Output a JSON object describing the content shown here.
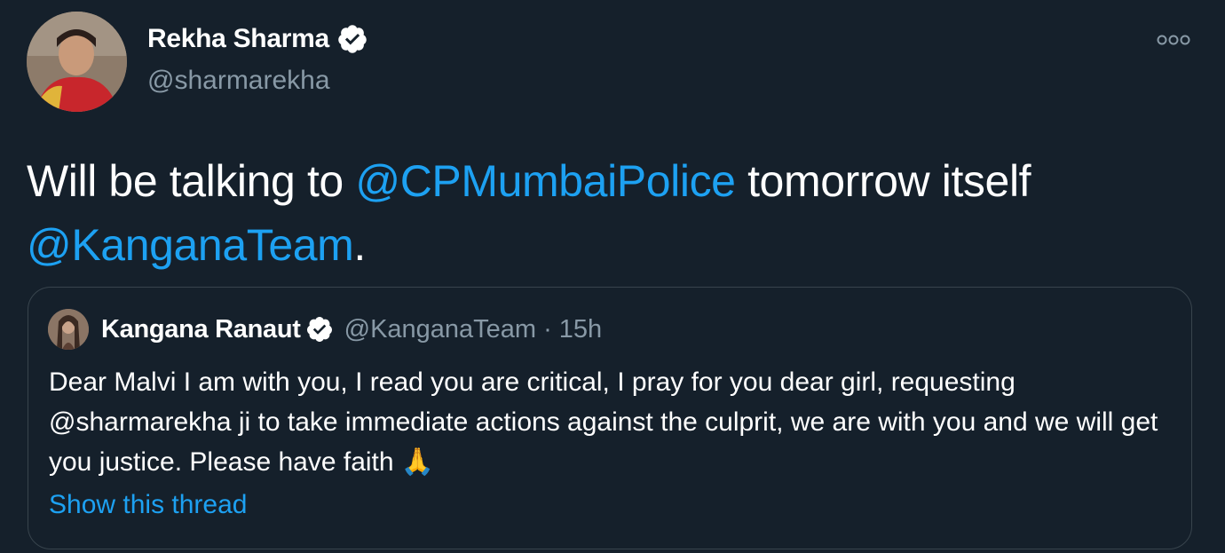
{
  "author": {
    "name": "Rekha Sharma",
    "handle": "@sharmarekha"
  },
  "tweet": {
    "text_before": "Will be talking to ",
    "mention_1": "@CPMumbaiPolice",
    "text_middle": " tomorrow itself",
    "mention_2": "@KanganaTeam",
    "text_after": "."
  },
  "quoted_tweet": {
    "name": "Kangana Ranaut",
    "handle": "@KanganaTeam",
    "separator": "·",
    "time": "15h",
    "text": "Dear Malvi I am with you, I read you are critical, I pray for you dear girl, requesting @sharmarekha ji to take immediate actions against the culprit, we are with you and we will get you justice. Please have faith",
    "emoji": "🙏",
    "show_thread_label": "Show this thread"
  },
  "colors": {
    "background": "#15202b",
    "link": "#1da1f2",
    "secondary_text": "#8899a6",
    "border": "#38444d"
  },
  "icons": {
    "verified": "verified-badge-icon",
    "more": "more-options-icon"
  }
}
